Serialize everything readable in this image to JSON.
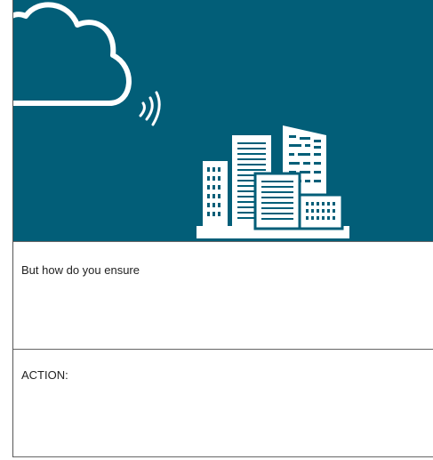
{
  "colors": {
    "hero_background": "#025e78",
    "illustration": "#ffffff",
    "divider": "#666666"
  },
  "icons": {
    "cloud": "cloud-icon",
    "signal": "signal-waves-icon",
    "city": "city-buildings-icon"
  },
  "section1": {
    "text": "But how do you ensure"
  },
  "section2": {
    "text": "ACTION:"
  }
}
